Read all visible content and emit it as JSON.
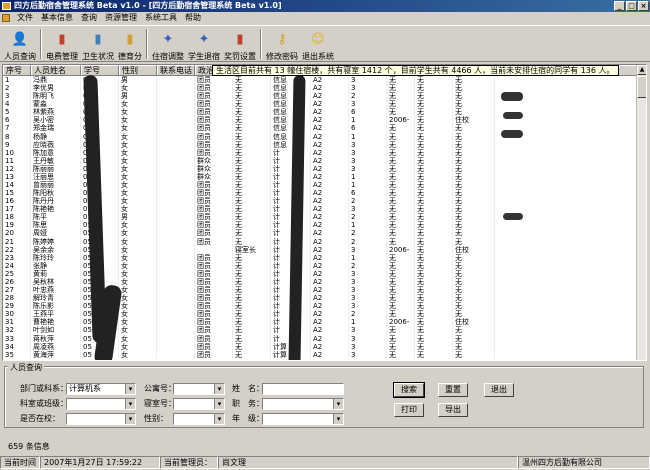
{
  "window": {
    "title": "四方后勤宿舍管理系统 Beta v1.0 - [四方后勤宿舍管理系统 Beta v1.0]",
    "min": "_",
    "max": "□",
    "close": "×"
  },
  "menu": [
    "文件",
    "基本信息",
    "查询",
    "资源管理",
    "系统工具",
    "帮助"
  ],
  "toolbar": [
    {
      "label": "人员查询",
      "icon": "user-search-icon",
      "glyph": "👤",
      "color": "#5a7fbf"
    },
    {
      "label": "电费管理",
      "icon": "electric-fee-icon",
      "glyph": "▮",
      "color": "#c04030"
    },
    {
      "label": "卫生状况",
      "icon": "hygiene-icon",
      "glyph": "▮",
      "color": "#4080c0"
    },
    {
      "label": "德育分",
      "icon": "moral-score-icon",
      "glyph": "▮",
      "color": "#d0a030"
    },
    {
      "label": "住宿调整",
      "icon": "dorm-adjust-icon",
      "glyph": "✦",
      "color": "#3060c0"
    },
    {
      "label": "学生退宿",
      "icon": "student-leave-icon",
      "glyph": "✦",
      "color": "#3060c0"
    },
    {
      "label": "奖罚设置",
      "icon": "reward-punish-icon",
      "glyph": "▮",
      "color": "#c04030"
    },
    {
      "label": "修改密码",
      "icon": "key-icon",
      "glyph": "⚷",
      "color": "#d0a030"
    },
    {
      "label": "退出系统",
      "icon": "exit-icon",
      "glyph": "☺",
      "color": "#e0b020"
    }
  ],
  "columns": [
    "序号",
    "人员姓名",
    "学号",
    "性别",
    "联系电话",
    "政治"
  ],
  "status_message": "生活区目前共有 13 幢住宿楼，共有寝室 1412 个，目前学生共有 4466 人，当前未安排住宿的同学有 136 人。",
  "rows": [
    [
      "1",
      "冯鼎",
      "05",
      "男",
      "",
      "团员",
      "无",
      "信息",
      "A2",
      "3",
      "无",
      "无",
      "无"
    ],
    [
      "2",
      "李优男",
      "05",
      "女",
      "",
      "团员",
      "无",
      "信息",
      "A2",
      "3",
      "无",
      "无",
      "无"
    ],
    [
      "3",
      "陈明飞",
      "05",
      "男",
      "",
      "团员",
      "无",
      "信息",
      "A2",
      "2",
      "无",
      "无",
      "无"
    ],
    [
      "4",
      "蒙淼",
      "05",
      "女",
      "",
      "团员",
      "无",
      "信息",
      "A2",
      "3",
      "无",
      "无",
      "无"
    ],
    [
      "5",
      "林紫燕",
      "05",
      "女",
      "",
      "团员",
      "无",
      "信息",
      "A2",
      "6",
      "无",
      "无",
      "无"
    ],
    [
      "6",
      "吴小密",
      "05",
      "女",
      "",
      "团员",
      "无",
      "信息",
      "A2",
      "1",
      "2006-",
      "无",
      "住校"
    ],
    [
      "7",
      "郑金瑞",
      "05",
      "女",
      "",
      "团员",
      "无",
      "信息",
      "A2",
      "6",
      "无",
      "无",
      "无"
    ],
    [
      "8",
      "杨静",
      "05",
      "女",
      "",
      "团员",
      "无",
      "信息",
      "A2",
      "1",
      "无",
      "无",
      "无"
    ],
    [
      "9",
      "应晓薇",
      "05",
      "女",
      "",
      "团员",
      "无",
      "信息",
      "A2",
      "3",
      "无",
      "无",
      "无"
    ],
    [
      "10",
      "陈加意",
      "05",
      "女",
      "",
      "团员",
      "无",
      "计",
      "A2",
      "3",
      "无",
      "无",
      "无"
    ],
    [
      "11",
      "王丹敏",
      "05",
      "女",
      "",
      "群众",
      "无",
      "计",
      "A2",
      "3",
      "无",
      "无",
      "无"
    ],
    [
      "12",
      "陈丽丽",
      "05",
      "女",
      "",
      "群众",
      "无",
      "计",
      "A2",
      "3",
      "无",
      "无",
      "无"
    ],
    [
      "13",
      "汪丽思",
      "05",
      "女",
      "",
      "群众",
      "无",
      "计",
      "A2",
      "1",
      "无",
      "无",
      "无"
    ],
    [
      "14",
      "曾丽丽",
      "05",
      "女",
      "",
      "团员",
      "无",
      "计",
      "A2",
      "1",
      "无",
      "无",
      "无"
    ],
    [
      "15",
      "陈阳秋",
      "05",
      "女",
      "",
      "团员",
      "无",
      "计",
      "A2",
      "6",
      "无",
      "无",
      "无"
    ],
    [
      "16",
      "陈丹丹",
      "05",
      "女",
      "",
      "团员",
      "无",
      "计",
      "A2",
      "2",
      "无",
      "无",
      "无"
    ],
    [
      "17",
      "陈艳艳",
      "05",
      "女",
      "",
      "团员",
      "无",
      "计",
      "A2",
      "3",
      "无",
      "无",
      "无"
    ],
    [
      "18",
      "陈平",
      "05",
      "男",
      "",
      "团员",
      "无",
      "计",
      "A2",
      "2",
      "无",
      "无",
      "无"
    ],
    [
      "19",
      "陈思",
      "05",
      "女",
      "",
      "团员",
      "无",
      "计",
      "A2",
      "1",
      "无",
      "无",
      "无"
    ],
    [
      "20",
      "周娅",
      "05",
      "女",
      "",
      "团员",
      "无",
      "计",
      "A2",
      "2",
      "无",
      "无",
      "无"
    ],
    [
      "21",
      "陈婷婷",
      "05",
      "女",
      "",
      "团员",
      "无",
      "计",
      "A2",
      "2",
      "无",
      "无",
      "无"
    ],
    [
      "22",
      "吴余余",
      "05",
      "女",
      "",
      "",
      "寝室长",
      "计",
      "A2",
      "3",
      "2006-",
      "无",
      "住校"
    ],
    [
      "23",
      "陈玲玲",
      "05",
      "女",
      "",
      "团员",
      "无",
      "计",
      "A2",
      "1",
      "无",
      "无",
      "无"
    ],
    [
      "24",
      "张静",
      "05",
      "女",
      "",
      "团员",
      "无",
      "计",
      "A2",
      "2",
      "无",
      "无",
      "无"
    ],
    [
      "25",
      "黄莉",
      "05",
      "女",
      "",
      "团员",
      "无",
      "计",
      "A2",
      "3",
      "无",
      "无",
      "无"
    ],
    [
      "26",
      "吴秋林",
      "05",
      "女",
      "",
      "团员",
      "无",
      "计",
      "A2",
      "3",
      "无",
      "无",
      "无"
    ],
    [
      "27",
      "叶忠燕",
      "05",
      "女",
      "",
      "团员",
      "无",
      "计",
      "A2",
      "3",
      "无",
      "无",
      "无"
    ],
    [
      "28",
      "解玲青",
      "05",
      "女",
      "",
      "团员",
      "无",
      "计",
      "A2",
      "3",
      "无",
      "无",
      "无"
    ],
    [
      "29",
      "陈乐影",
      "05",
      "女",
      "",
      "团员",
      "无",
      "计",
      "A2",
      "3",
      "无",
      "无",
      "无"
    ],
    [
      "30",
      "王燕平",
      "05",
      "女",
      "",
      "团员",
      "无",
      "计",
      "A2",
      "2",
      "无",
      "无",
      "无"
    ],
    [
      "31",
      "曹艳艳",
      "05",
      "女",
      "",
      "团员",
      "无",
      "计",
      "A2",
      "1",
      "2006-",
      "无",
      "住校"
    ],
    [
      "32",
      "叶剑如",
      "05",
      "女",
      "",
      "团员",
      "无",
      "计",
      "A2",
      "3",
      "无",
      "无",
      "无"
    ],
    [
      "33",
      "蒋秋萍",
      "05",
      "女",
      "",
      "团员",
      "无",
      "计",
      "A2",
      "3",
      "无",
      "无",
      "无"
    ],
    [
      "34",
      "周凌燕",
      "05",
      "女",
      "",
      "团员",
      "无",
      "计算",
      "A2",
      "3",
      "无",
      "无",
      "无"
    ],
    [
      "35",
      "黄海萍",
      "05",
      "女",
      "",
      "团员",
      "无",
      "计算",
      "A2",
      "3",
      "无",
      "无",
      "无"
    ]
  ],
  "search": {
    "title": "人员查询",
    "dept_label": "部门或科系：",
    "dept_value": "计算机系",
    "class_label": "科室或班级：",
    "live_label": "是否在校：",
    "apartment_label": "公寓号：",
    "room_label": "寝室号：",
    "gender_label": "性别：",
    "name_label": "姓　名：",
    "position_label": "职　务：",
    "grade_label": "年　级：",
    "search_btn": "搜索",
    "reset_btn": "重置",
    "back_btn": "退出",
    "print_btn": "打印",
    "export_btn": "导出"
  },
  "record_count": "659 条信息",
  "statusbar": {
    "time_label": "当前时间",
    "time_value": "2007年1月27日 17:59:22",
    "admin_label": "当前管理员：",
    "admin_value": "尚文理",
    "company": "温州四方后勤有限公司"
  }
}
